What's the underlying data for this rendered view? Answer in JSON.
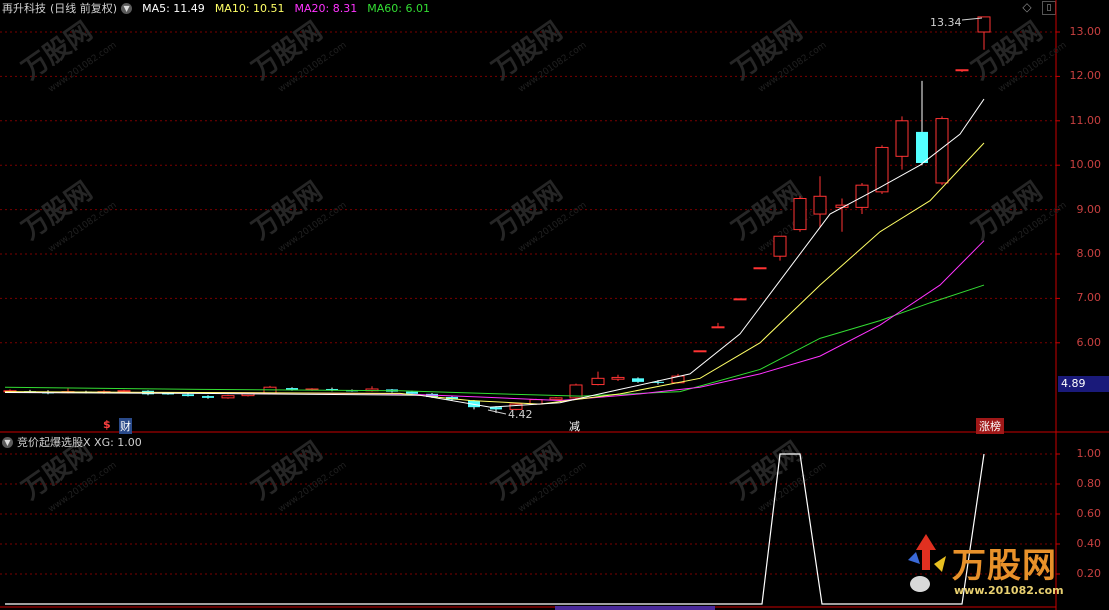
{
  "header": {
    "stock_name": "再升科技",
    "period": "(日线 前复权)",
    "ma5_label": "MA5: 11.49",
    "ma10_label": "MA10: 10.51",
    "ma20_label": "MA20: 8.31",
    "ma60_label": "MA60: 6.01"
  },
  "colors": {
    "up": "#ff3333",
    "down": "#54ffff",
    "ma5": "#ffffff",
    "ma10": "#ffff66",
    "ma20": "#ff33ff",
    "ma60": "#33dd33",
    "grid": "#7a0000",
    "axis": "#c80000"
  },
  "price_axis": [
    "13.00",
    "12.00",
    "11.00",
    "10.00",
    "9.00",
    "8.00",
    "7.00",
    "6.00"
  ],
  "last_price": "4.89",
  "high_label": "13.34",
  "low_label": "4.42",
  "markers": {
    "finance": "财",
    "dollar": "$",
    "reduce": "减",
    "limit_list": "涨榜"
  },
  "indicator": {
    "header": "竞价起爆选股X XG: 1.00",
    "axis": [
      "1.00",
      "0.80",
      "0.60",
      "0.40",
      "0.20"
    ]
  },
  "brand": {
    "name": "万股网",
    "url": "www.201082.com"
  }
}
